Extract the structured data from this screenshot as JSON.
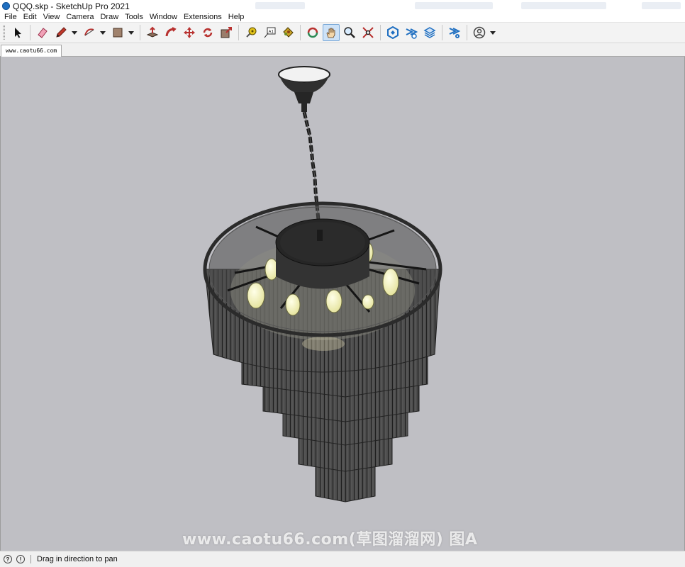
{
  "window": {
    "title": "QQQ.skp - SketchUp Pro 2021"
  },
  "menu": [
    "File",
    "Edit",
    "View",
    "Camera",
    "Draw",
    "Tools",
    "Window",
    "Extensions",
    "Help"
  ],
  "toolbar": {
    "tools": [
      {
        "name": "select-tool",
        "icon": "arrow-cursor-icon"
      },
      {
        "name": "eraser-tool",
        "icon": "eraser-icon"
      },
      {
        "name": "pencil-tool",
        "icon": "pencil-icon",
        "dropdown": true
      },
      {
        "name": "arc-tool",
        "icon": "arc-icon",
        "dropdown": true
      },
      {
        "name": "rectangle-tool",
        "icon": "rectangle-icon",
        "dropdown": true
      },
      {
        "name": "push-pull-tool",
        "icon": "push-pull-icon"
      },
      {
        "name": "follow-me-tool",
        "icon": "follow-me-icon"
      },
      {
        "name": "move-tool",
        "icon": "move-icon"
      },
      {
        "name": "rotate-tool",
        "icon": "rotate-icon"
      },
      {
        "name": "scale-tool",
        "icon": "scale-icon"
      },
      {
        "name": "tape-measure-tool",
        "icon": "tape-measure-icon"
      },
      {
        "name": "text-tool",
        "icon": "text-label-icon"
      },
      {
        "name": "paint-bucket-tool",
        "icon": "paint-bucket-icon"
      },
      {
        "name": "orbit-tool",
        "icon": "orbit-icon"
      },
      {
        "name": "pan-tool",
        "icon": "pan-hand-icon",
        "active": true
      },
      {
        "name": "zoom-tool",
        "icon": "zoom-icon"
      },
      {
        "name": "zoom-extents-tool",
        "icon": "zoom-extents-icon"
      },
      {
        "name": "3d-warehouse-button",
        "icon": "warehouse-icon"
      },
      {
        "name": "extension-warehouse-button",
        "icon": "extension-warehouse-icon"
      },
      {
        "name": "layout-button",
        "icon": "layers-icon"
      },
      {
        "name": "extension-manager-button",
        "icon": "extension-manager-icon"
      },
      {
        "name": "account-button",
        "icon": "user-profile-icon",
        "dropdown": true
      }
    ]
  },
  "scene_tab": "www.caotu66.com",
  "viewport": {
    "background": "#bfbfc4",
    "watermark": "www.caotu66.com(草图溜溜网) 图A"
  },
  "status": {
    "text": "Drag in direction to pan"
  },
  "colors": {
    "accent": "#1f6fc1",
    "tool_red": "#b8312f",
    "model_dark": "#3c3c3c"
  }
}
